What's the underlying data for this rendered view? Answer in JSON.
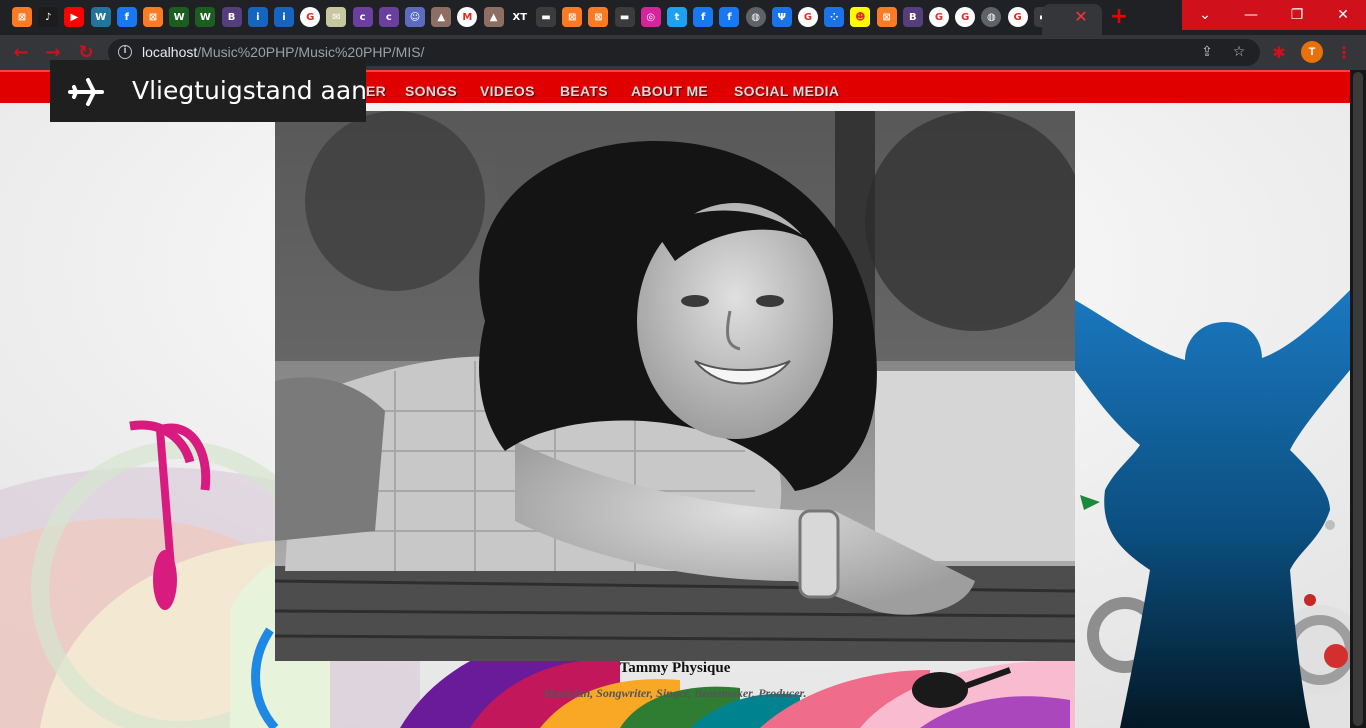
{
  "browser": {
    "tabs": [
      {
        "icon": "xampp-icon",
        "color": "#fb7a24",
        "glyph": "⊠"
      },
      {
        "icon": "music-note-icon",
        "color": "#1c1c1c",
        "glyph": "♪"
      },
      {
        "icon": "youtube-icon",
        "color": "#ff0000",
        "glyph": "▶"
      },
      {
        "icon": "wordpress-icon",
        "color": "#21759b",
        "glyph": "W"
      },
      {
        "icon": "facebook-icon",
        "color": "#1877f2",
        "glyph": "f"
      },
      {
        "icon": "xampp-icon",
        "color": "#fb7a24",
        "glyph": "⊠"
      },
      {
        "icon": "w-green-icon",
        "color": "#1b5e20",
        "glyph": "W"
      },
      {
        "icon": "w-green-icon",
        "color": "#1b5e20",
        "glyph": "W"
      },
      {
        "icon": "bootstrap-icon",
        "color": "#563d7c",
        "glyph": "B"
      },
      {
        "icon": "info-icon",
        "color": "#1565c0",
        "glyph": "i"
      },
      {
        "icon": "info-icon",
        "color": "#1565c0",
        "glyph": "i"
      },
      {
        "icon": "google-icon",
        "color": "#ffffff",
        "glyph": "G"
      },
      {
        "icon": "mail-icon",
        "color": "#c8c8a0",
        "glyph": "✉"
      },
      {
        "icon": "coloris-icon",
        "color": "#6a3fa0",
        "glyph": "c"
      },
      {
        "icon": "coloris-icon",
        "color": "#6a3fa0",
        "glyph": "c"
      },
      {
        "icon": "chat-icon",
        "color": "#5c6bc0",
        "glyph": "☺"
      },
      {
        "icon": "hat-icon",
        "color": "#8d6e63",
        "glyph": "▲"
      },
      {
        "icon": "gmail-icon",
        "color": "#ffffff",
        "glyph": "M"
      },
      {
        "icon": "hat-icon",
        "color": "#8d6e63",
        "glyph": "▲"
      },
      {
        "icon": "xt-icon",
        "color": "#202124",
        "glyph": "XT"
      },
      {
        "icon": "dark-page-icon",
        "color": "#3c3c3c",
        "glyph": "▬"
      },
      {
        "icon": "xampp-icon",
        "color": "#fb7a24",
        "glyph": "⊠"
      },
      {
        "icon": "xampp-icon",
        "color": "#fb7a24",
        "glyph": "⊠"
      },
      {
        "icon": "dark-page-icon",
        "color": "#3c3c3c",
        "glyph": "▬"
      },
      {
        "icon": "instagram-icon",
        "color": "#d6249f",
        "glyph": "◎"
      },
      {
        "icon": "twitter-icon",
        "color": "#1da1f2",
        "glyph": "t"
      },
      {
        "icon": "facebook-icon",
        "color": "#1877f2",
        "glyph": "f"
      },
      {
        "icon": "facebook-icon",
        "color": "#1877f2",
        "glyph": "f"
      },
      {
        "icon": "globe-icon",
        "color": "#5f6368",
        "glyph": "◍"
      },
      {
        "icon": "psi-icon",
        "color": "#1a73e8",
        "glyph": "Ψ"
      },
      {
        "icon": "google-icon",
        "color": "#ffffff",
        "glyph": "G"
      },
      {
        "icon": "dots-icon",
        "color": "#1a73e8",
        "glyph": "⁘"
      },
      {
        "icon": "snapchat-icon",
        "color": "#fffc00",
        "glyph": "☻"
      },
      {
        "icon": "xampp-icon",
        "color": "#fb7a24",
        "glyph": "⊠"
      },
      {
        "icon": "bootstrap-icon",
        "color": "#563d7c",
        "glyph": "B"
      },
      {
        "icon": "google-icon",
        "color": "#ffffff",
        "glyph": "G"
      },
      {
        "icon": "google-icon",
        "color": "#ffffff",
        "glyph": "G"
      },
      {
        "icon": "globe-icon",
        "color": "#5f6368",
        "glyph": "◍"
      },
      {
        "icon": "google-icon",
        "color": "#ffffff",
        "glyph": "G"
      },
      {
        "icon": "dark-page-icon",
        "color": "#3c3c3c",
        "glyph": "▬"
      }
    ],
    "active_tab_close": "✕",
    "new_tab": "+",
    "window_controls": {
      "tab_search": "⌄",
      "minimize": "—",
      "restore": "❐",
      "close": "✕"
    },
    "nav": {
      "back": "←",
      "forward": "→",
      "reload": "↻"
    },
    "address": {
      "info": "i",
      "host": "localhost",
      "path": "/Music%20PHP/Music%20PHP/MIS/"
    },
    "share": "⇪",
    "bookmark": "☆",
    "extension": "✱",
    "profile_initial": "T",
    "menu": "⋮"
  },
  "site": {
    "nav_items": [
      "ER",
      "SONGS",
      "VIDEOS",
      "BEATS",
      "ABOUT ME",
      "SOCIAL MEDIA"
    ],
    "artist_name": "Tammy Physique",
    "artist_roles": "Musician, Songwriter, Singer, Beatsmaker, Producer."
  },
  "notification": {
    "text": "Vliegtuigstand aan",
    "icon": "airplane-icon"
  },
  "colors": {
    "brand_red": "#e00000",
    "chrome_red": "#d0101a",
    "toast_bg": "#1f1f1f"
  }
}
